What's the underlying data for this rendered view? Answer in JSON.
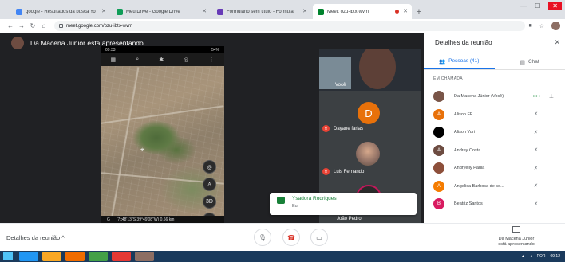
{
  "browser": {
    "tabs": [
      {
        "title": "google - Resultados da busca Yo",
        "color": "#4285f4"
      },
      {
        "title": "Meu Drive - Google Drive",
        "color": "#0f9d58"
      },
      {
        "title": "Formulário sem título - Formulár",
        "color": "#673ab7"
      },
      {
        "title": "Meet: ozu-ibtx-wvm",
        "color": "#00832d",
        "active": true,
        "recording": true
      }
    ],
    "new_tab": "+",
    "url": "meet.google.com/ozu-ibtx-wvm"
  },
  "stage": {
    "presenter_label": "Da Macena Júnior está apresentando",
    "phone": {
      "status_left": "09:33",
      "status_right": "54%",
      "footer": "(7x48'13\"S  39°49'08\"W) 0.66 km"
    },
    "tiles": [
      {
        "name": "Você"
      },
      {
        "name": "Dayane farias",
        "initial": "D",
        "color": "#e8710a"
      },
      {
        "name": "Luis Fernando"
      },
      {
        "name": "João Pedro"
      }
    ],
    "toast": {
      "title": "Ysadora Rodrigues",
      "subtitle": "Eu"
    }
  },
  "panel": {
    "title": "Detalhes da reunião",
    "tab_people": "Pessoas (41)",
    "tab_chat": "Chat",
    "section_label": "EM CHAMADA",
    "participants": [
      {
        "name": "Da Macena Júnior (Você)",
        "initial": "",
        "color": "#795548"
      },
      {
        "name": "Alison FF",
        "initial": "A",
        "color": "#e8710a"
      },
      {
        "name": "Alison Yuri",
        "initial": "",
        "color": "#000000"
      },
      {
        "name": "Andrey Costa",
        "initial": "A",
        "color": "#6d4c41"
      },
      {
        "name": "Andryelly Paula",
        "initial": "",
        "color": "#8d4f3a"
      },
      {
        "name": "Angelica Barbosa de so...",
        "initial": "A",
        "color": "#f57c00"
      },
      {
        "name": "Beatriz Santos",
        "initial": "B",
        "color": "#d81b60"
      }
    ]
  },
  "bottom": {
    "details_label": "Detalhes da reunião",
    "presenting_line1": "Da Macena Júnior",
    "presenting_line2": "está apresentando"
  },
  "taskbar": {
    "lang": "POR",
    "time": "09:12"
  }
}
